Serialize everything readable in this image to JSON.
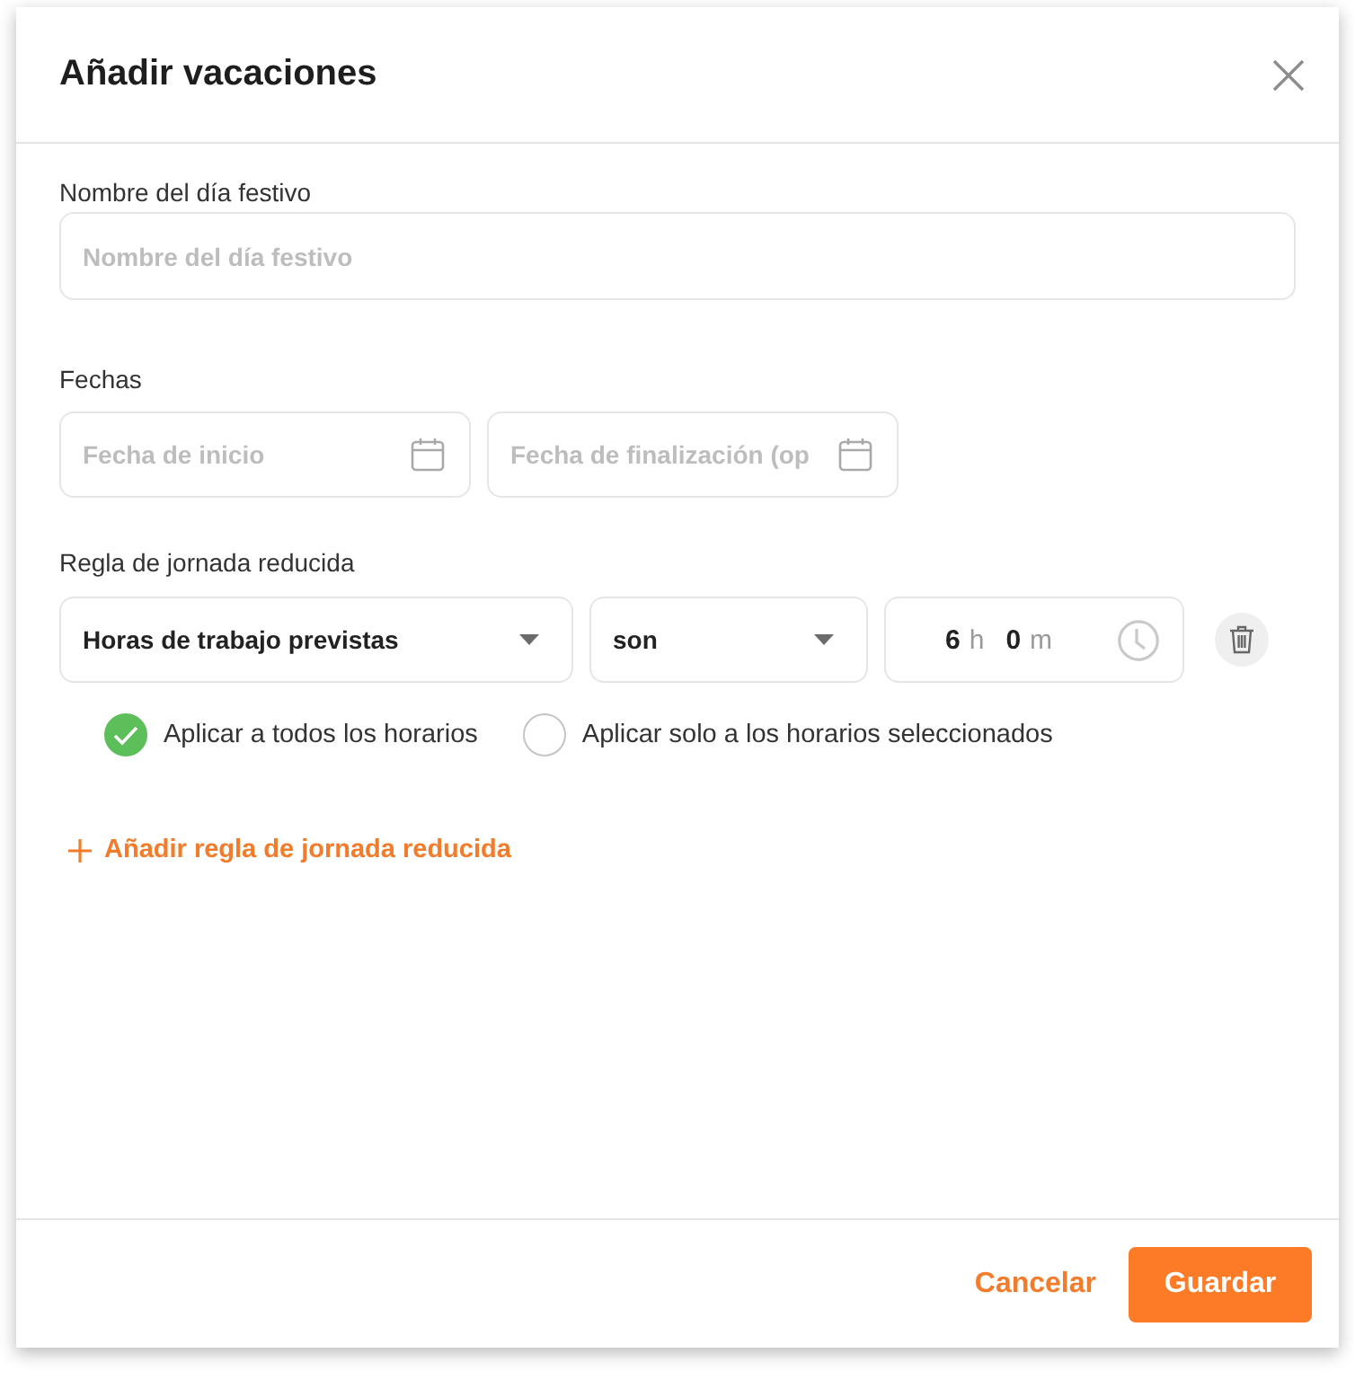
{
  "dialog": {
    "title": "Añadir vacaciones"
  },
  "name_field": {
    "label": "Nombre del día festivo",
    "placeholder": "Nombre del día festivo"
  },
  "dates": {
    "label": "Fechas",
    "fields": [
      {
        "placeholder": "Fecha de inicio"
      },
      {
        "placeholder": "Fecha de finalización (op"
      }
    ]
  },
  "reduced_rule": {
    "label": "Regla de jornada reducida",
    "condition": {
      "value": "Horas de trabajo previstas"
    },
    "operator": {
      "value": "son"
    },
    "duration": {
      "hours": "6",
      "hours_unit": "h",
      "minutes": "0",
      "minutes_unit": "m"
    },
    "apply_options": [
      {
        "label": "Aplicar a todos los horarios",
        "selected": true
      },
      {
        "label": "Aplicar solo a los horarios seleccionados",
        "selected": false
      }
    ]
  },
  "add_rule_link": {
    "label": "Añadir regla de jornada reducida"
  },
  "footer": {
    "buttons": [
      {
        "label": "Cancelar",
        "kind": "text"
      },
      {
        "label": "Guardar",
        "kind": "primary"
      }
    ]
  }
}
